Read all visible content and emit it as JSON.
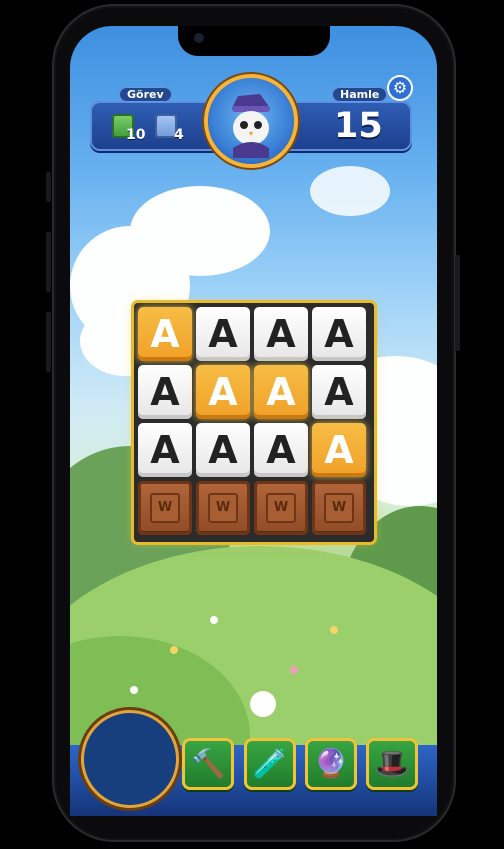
{
  "hud": {
    "goal_label": "Görev",
    "moves_label": "Hamle",
    "moves_value": "15",
    "goals": [
      {
        "icon": "grass-tile-icon",
        "count": "10"
      },
      {
        "icon": "window-tile-icon",
        "count": "4"
      }
    ]
  },
  "board": {
    "rows": [
      [
        "A",
        "A",
        "A",
        "A"
      ],
      [
        "A",
        "A",
        "A",
        "A"
      ],
      [
        "A",
        "A",
        "A",
        "A"
      ],
      [
        "W",
        "W",
        "W",
        "W"
      ]
    ],
    "highlighted": [
      [
        0,
        0
      ],
      [
        1,
        1
      ],
      [
        1,
        2
      ],
      [
        2,
        3
      ]
    ]
  },
  "boosters": [
    {
      "icon": "hammer-booster-icon"
    },
    {
      "icon": "potion-booster-icon"
    },
    {
      "icon": "crystal-ball-booster-icon"
    },
    {
      "icon": "magic-hat-booster-icon"
    }
  ],
  "colors": {
    "gold_tile": "#f0a028",
    "white_tile": "#ffffff",
    "crate": "#8f4b26",
    "hud": "#1d3f8c"
  }
}
